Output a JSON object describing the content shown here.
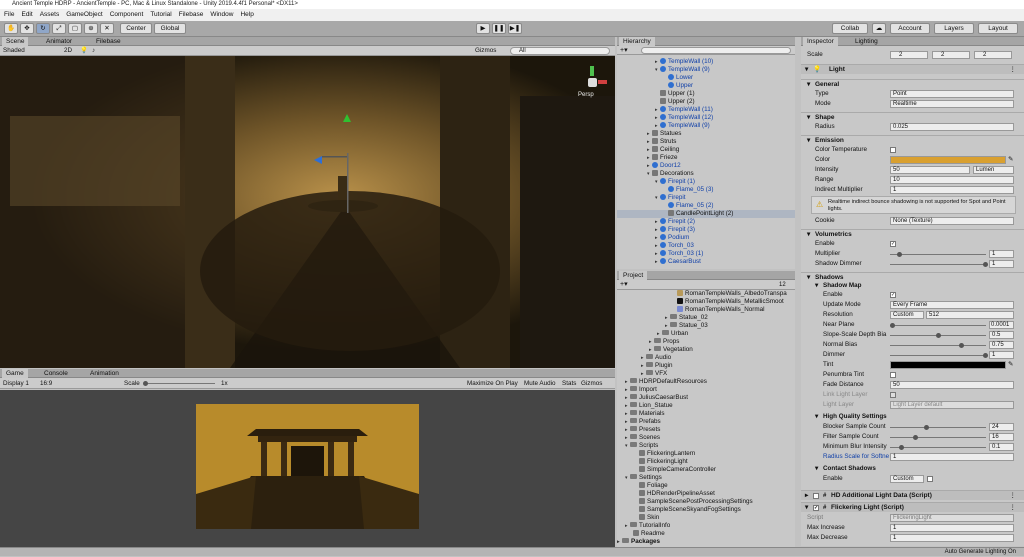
{
  "window_title": "Ancient Temple HDRP - AncientTemple - PC, Mac & Linux Standalone - Unity 2019.4.4f1 Personal* <DX11>",
  "menu": [
    "File",
    "Edit",
    "Assets",
    "GameObject",
    "Component",
    "Tutorial",
    "Filebase",
    "Window",
    "Help"
  ],
  "toolbar": {
    "center": "Center",
    "global": "Global",
    "collab": "Collab",
    "account": "Account",
    "layers": "Layers",
    "layout": "Layout"
  },
  "scene_tabs": [
    "Scene",
    "Animator",
    "Filebase"
  ],
  "scene_bar": {
    "shading": "Shaded",
    "mode2d": "2D",
    "gizmos": "Gizmos",
    "search": "All",
    "persp": "Persp"
  },
  "game_tabs": [
    "Game",
    "Console",
    "Animation"
  ],
  "game_bar": {
    "display": "Display 1",
    "aspect": "16:9",
    "scale_label": "Scale",
    "scale_value": "1x",
    "maximize": "Maximize On Play",
    "mute": "Mute Audio",
    "stats": "Stats",
    "gizmos": "Gizmos"
  },
  "hierarchy_tab": "Hierarchy",
  "hierarchy": [
    "TempleWall (10)",
    "TempleWall (9)",
    "Lower",
    "Upper",
    "Upper (1)",
    "Upper (2)",
    "TempleWall (11)",
    "TempleWall (12)",
    "TempleWall (9)",
    "Statues",
    "Struts",
    "Ceiling",
    "Frieze",
    "Door12",
    "Decorations",
    "Firepit (1)",
    "Flame_05 (3)",
    "Firepit",
    "Flame_05 (2)",
    "CandlePointLight (2)",
    "Firepit (2)",
    "Firepit (3)",
    "Podium",
    "Torch_03",
    "Torch_03 (1)",
    "CaesarBust"
  ],
  "project_tab": "Project",
  "project_count": "12",
  "project": [
    "RomanTempleWalls_AlbedoTranspa",
    "RomanTempleWalls_MetallicSmoot",
    "RomanTempleWalls_Normal",
    "Statue_02",
    "Statue_03",
    "Urban",
    "Props",
    "Vegetation",
    "Audio",
    "Plugin",
    "VFX",
    "HDRPDefaultResources",
    "Import",
    "JuliusCaesarBust",
    "Lion_Statue",
    "Materials",
    "Prefabs",
    "Presets",
    "Scenes",
    "Scripts",
    "FlickeringLantern",
    "FlickeringLight",
    "SimpleCameraController",
    "Settings",
    "Foliage",
    "HDRenderPipelineAsset",
    "SampleScenePostProcessingSettings",
    "SampleSceneSkyandFogSettings",
    "Skin",
    "TutorialInfo",
    "Readme",
    "Packages"
  ],
  "inspector_tabs": [
    "Inspector",
    "Lighting"
  ],
  "inspector": {
    "scale_label": "Scale",
    "sx": "2",
    "sy": "2",
    "sz": "2",
    "light_header": "Light",
    "general": "General",
    "type_label": "Type",
    "type_value": "Point",
    "mode_label": "Mode",
    "mode_value": "Realtime",
    "shape": "Shape",
    "radius_label": "Radius",
    "radius_value": "0.025",
    "emission": "Emission",
    "colortemp_label": "Color Temperature",
    "color_label": "Color",
    "intensity_label": "Intensity",
    "intensity_value": "50",
    "intensity_unit": "Lumen",
    "range_label": "Range",
    "range_value": "10",
    "indirect_label": "Indirect Multiplier",
    "indirect_value": "1",
    "warning": "Realtime indirect bounce shadowing is not supported for Spot and Point lights.",
    "cookie_label": "Cookie",
    "cookie_value": "None (Texture)",
    "volumetrics": "Volumetrics",
    "enable_label": "Enable",
    "multiplier_label": "Multiplier",
    "multiplier_value": "1",
    "dimmer_label": "Shadow Dimmer",
    "dimmer_value": "1",
    "shadows": "Shadows",
    "shadowmap": "Shadow Map",
    "sm_enable": "Enable",
    "update_label": "Update Mode",
    "update_value": "Every Frame",
    "res_label": "Resolution",
    "res_mode": "Custom",
    "res_value": "512",
    "near_label": "Near Plane",
    "near_value": "0.0001",
    "slope_label": "Slope-Scale Depth Bia",
    "slope_value": "0.5",
    "normal_label": "Normal Bias",
    "normal_value": "0.75",
    "dim_label": "Dimmer",
    "dim_value": "1",
    "tint_label": "Tint",
    "penumbra_label": "Penumbra Tint",
    "fade_label": "Fade Distance",
    "fade_value": "50",
    "link_label": "Link Light Layer",
    "lightlayer_label": "Light Layer",
    "lightlayer_value": "Light Layer default",
    "hq": "High Quality Settings",
    "blocker_label": "Blocker Sample Count",
    "blocker_value": "24",
    "filter_label": "Filter Sample Count",
    "filter_value": "16",
    "minblur_label": "Minimum Blur Intensity",
    "minblur_value": "0.1",
    "radscale_label": "Radius Scale for Softne",
    "radscale_value": "1",
    "contact": "Contact Shadows",
    "c_enable": "Enable",
    "c_value": "Custom",
    "hdadd": "HD Additional Light Data (Script)",
    "flicker": "Flickering Light (Script)",
    "script_label": "Script",
    "script_value": "FlickeringLight",
    "maxinc_label": "Max Increase",
    "maxinc_value": "1",
    "maxdec_label": "Max Decrease",
    "maxdec_value": "1"
  },
  "status": "Auto Generate Lighting On",
  "colors": {
    "light_color": "#d9a030",
    "tint": "#000000"
  }
}
